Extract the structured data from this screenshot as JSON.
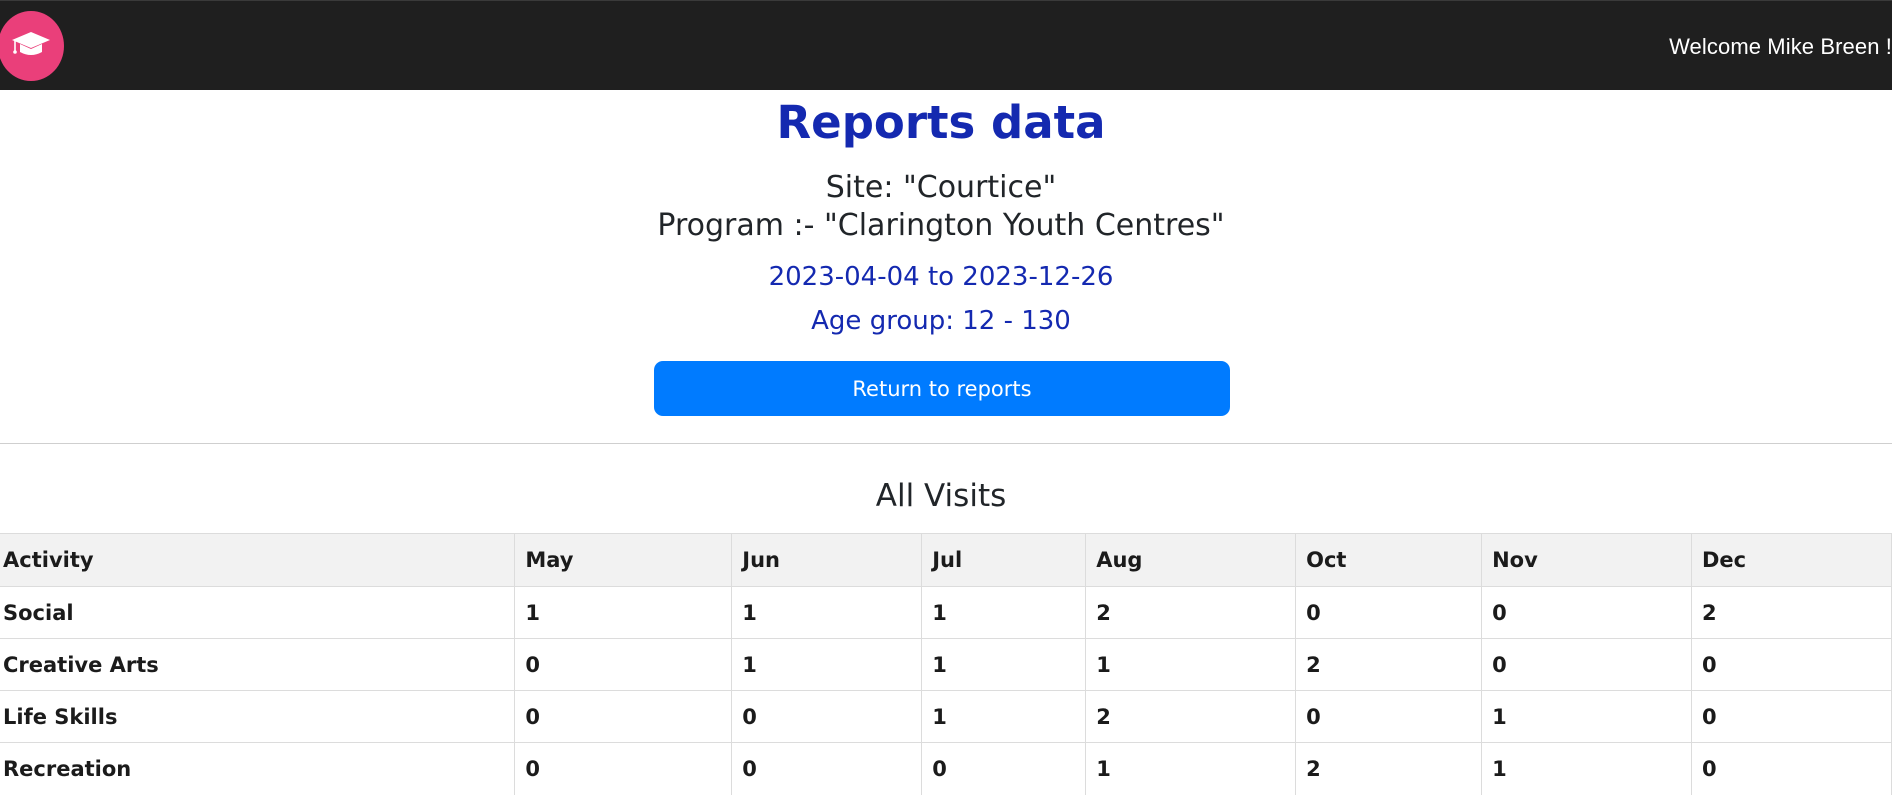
{
  "navbar": {
    "logo_icon": "graduation-cap-icon",
    "brand_color": "#ea3f7a",
    "welcome_text": "Welcome Mike Breen !"
  },
  "report": {
    "title": "Reports data",
    "site": "Site: \"Courtice\"",
    "program": "Program :- \"Clarington Youth Centres\"",
    "date_range": "2023-04-04 to 2023-12-26",
    "age_group": "Age group: 12 - 130",
    "return_button": "Return to reports",
    "accent_color": "#1429b0",
    "button_color": "#007bff"
  },
  "visits": {
    "title": "All Visits",
    "columns": [
      "Activity",
      "May",
      "Jun",
      "Jul",
      "Aug",
      "Oct",
      "Nov",
      "Dec"
    ],
    "rows": [
      [
        "Social",
        "1",
        "1",
        "1",
        "2",
        "0",
        "0",
        "2"
      ],
      [
        "Creative Arts",
        "0",
        "1",
        "1",
        "1",
        "2",
        "0",
        "0"
      ],
      [
        "Life Skills",
        "0",
        "0",
        "1",
        "2",
        "0",
        "1",
        "0"
      ],
      [
        "Recreation",
        "0",
        "0",
        "0",
        "1",
        "2",
        "1",
        "0"
      ]
    ]
  }
}
